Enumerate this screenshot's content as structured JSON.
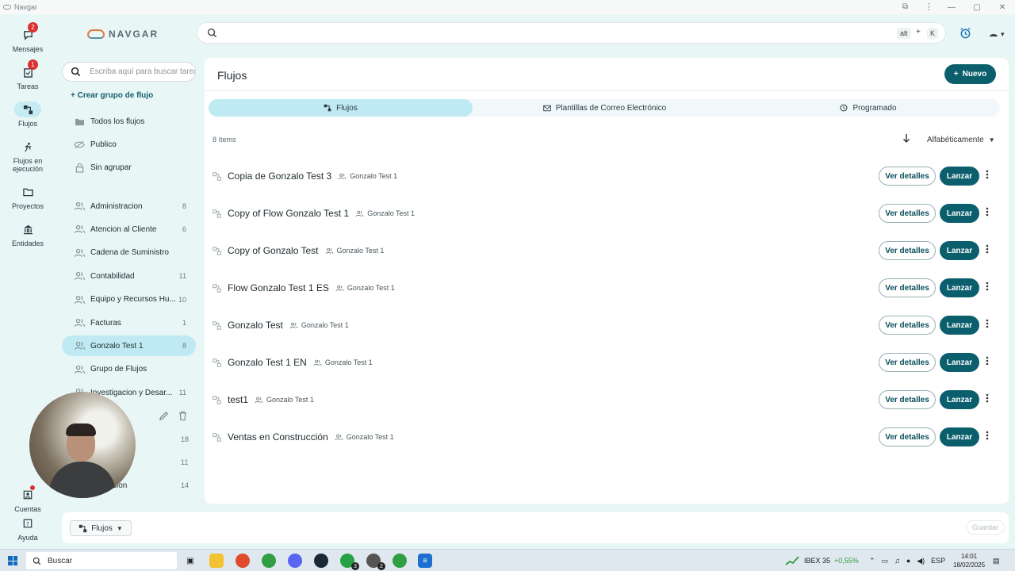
{
  "window": {
    "title": "Navgar",
    "controls": [
      "—",
      "▢",
      "✕"
    ]
  },
  "brand": {
    "name": "NAVGAR"
  },
  "topbar": {
    "shortcut_key1": "alt",
    "shortcut_plus": "+",
    "shortcut_key2": "K"
  },
  "rail": {
    "items": [
      {
        "label": "Mensajes",
        "badge": "2"
      },
      {
        "label": "Tareas",
        "badge": "1"
      },
      {
        "label": "Flujos"
      },
      {
        "label": "Flujos en ejecución"
      },
      {
        "label": "Proyectos"
      },
      {
        "label": "Entidades"
      },
      {
        "label": "Cuentas"
      },
      {
        "label": "Ayuda"
      }
    ]
  },
  "sidebar": {
    "search_placeholder": "Escriba aquí para buscar tareas",
    "create_group": "+ Crear grupo de flujo",
    "filters": [
      "Todos los flujos",
      "Publico",
      "Sin agrupar"
    ],
    "groups": [
      {
        "label": "Administracion",
        "count": "8"
      },
      {
        "label": "Atencion al Cliente",
        "count": "6"
      },
      {
        "label": "Cadena de Suministro",
        "count": ""
      },
      {
        "label": "Contabilidad",
        "count": "11"
      },
      {
        "label": "Equipo y Recursos Hu...",
        "count": "10"
      },
      {
        "label": "Facturas",
        "count": "1"
      },
      {
        "label": "Gonzalo Test 1",
        "count": "8"
      },
      {
        "label": "Grupo de Flujos",
        "count": ""
      },
      {
        "label": "Investigacion y Desar...",
        "count": "11"
      }
    ],
    "hidden_counts": [
      "18",
      "11",
      "14"
    ],
    "hidden_tail": "cion"
  },
  "main": {
    "title": "Flujos",
    "new_button": "Nuevo",
    "tabs": [
      "Flujos",
      "Plantillas de Correo Electrónico",
      "Programado"
    ],
    "item_count": "8 ítems",
    "sort_label": "Alfabéticamente",
    "details_label": "Ver detalles",
    "launch_label": "Lanzar",
    "rows": [
      {
        "name": "Copia de Gonzalo Test 3",
        "owner": "Gonzalo Test 1"
      },
      {
        "name": "Copy of Flow Gonzalo Test 1",
        "owner": "Gonzalo Test 1"
      },
      {
        "name": "Copy of Gonzalo Test",
        "owner": "Gonzalo Test 1"
      },
      {
        "name": "Flow Gonzalo Test 1 ES",
        "owner": "Gonzalo Test 1"
      },
      {
        "name": "Gonzalo Test",
        "owner": "Gonzalo Test 1"
      },
      {
        "name": "Gonzalo Test 1 EN",
        "owner": "Gonzalo Test 1"
      },
      {
        "name": "test1",
        "owner": "Gonzalo Test 1"
      },
      {
        "name": "Ventas en Construcción",
        "owner": "Gonzalo Test 1"
      }
    ]
  },
  "bottombar": {
    "selector_label": "Flujos",
    "save_label": "Guardar"
  },
  "taskbar": {
    "search_label": "Buscar",
    "ticker_name": "IBEX 35",
    "ticker_change": "+0,55%",
    "language": "ESP",
    "time": "14:01",
    "date": "18/02/2025",
    "whatsapp_badge": "3",
    "app_badge": "2"
  },
  "colors": {
    "accent": "#0b5f6d",
    "active_tab": "#bfeaf3",
    "background": "#e9f6f6",
    "badge": "#d93030"
  }
}
